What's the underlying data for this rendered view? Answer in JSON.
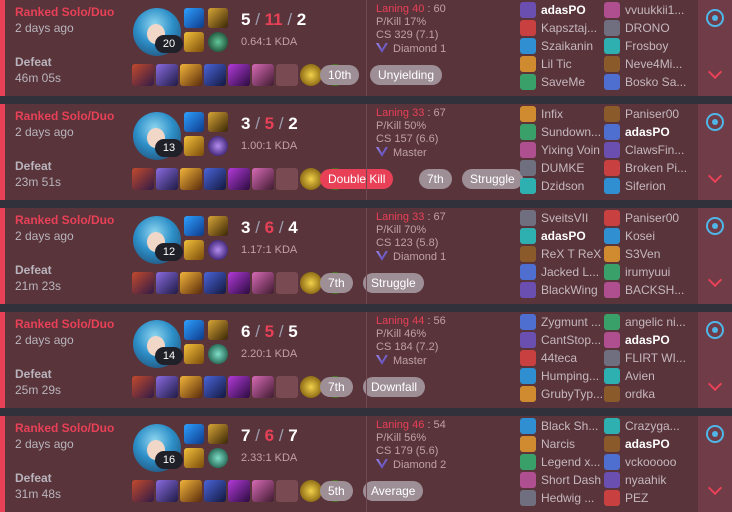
{
  "matches": [
    {
      "queue": "Ranked Solo/Duo",
      "ago": "2 days ago",
      "result": "Defeat",
      "duration": "46m 05s",
      "level": "20",
      "kills": "5",
      "deaths": "11",
      "assists": "2",
      "ratio": "0.64:1 KDA",
      "laning_label": "Laning",
      "laning_left": "40",
      "laning_right": "60",
      "pkill": "P/Kill 17%",
      "cs": "CS 329 (7.1)",
      "rank": "Diamond 1",
      "badges": [
        "10th",
        "Unyielding"
      ],
      "team_left": [
        "adasPO",
        "Kapsztaj...",
        "Szaikanin",
        "Lil Tic",
        "SaveMe"
      ],
      "team_right": [
        "vvuukkii1...",
        "DRONO",
        "Frosboy",
        "Neve4Mi...",
        "Bosko Sa..."
      ],
      "me": "L0"
    },
    {
      "queue": "Ranked Solo/Duo",
      "ago": "2 days ago",
      "result": "Defeat",
      "duration": "23m 51s",
      "level": "13",
      "kills": "3",
      "deaths": "5",
      "assists": "2",
      "ratio": "1.00:1 KDA",
      "laning_label": "Laning",
      "laning_left": "33",
      "laning_right": "67",
      "pkill": "P/Kill 50%",
      "cs": "CS 157 (6.6)",
      "rank": "Master",
      "badges": [
        "Double Kill",
        "7th",
        "Struggle"
      ],
      "team_left": [
        "Infix",
        "Sundown...",
        "Yixing Voin",
        "DUMKE",
        "Dzidson"
      ],
      "team_right": [
        "Paniser00",
        "adasPO",
        "ClawsFin...",
        "Broken Pi...",
        "Siferion"
      ],
      "me": "R1"
    },
    {
      "queue": "Ranked Solo/Duo",
      "ago": "2 days ago",
      "result": "Defeat",
      "duration": "21m 23s",
      "level": "12",
      "kills": "3",
      "deaths": "6",
      "assists": "4",
      "ratio": "1.17:1 KDA",
      "laning_label": "Laning",
      "laning_left": "33",
      "laning_right": "67",
      "pkill": "P/Kill 70%",
      "cs": "CS 123 (5.8)",
      "rank": "Diamond 1",
      "badges": [
        "7th",
        "Struggle"
      ],
      "team_left": [
        "SveitsVII",
        "adasPO",
        "ReX T ReX",
        "Jacked L...",
        "BlackWing"
      ],
      "team_right": [
        "Paniser00",
        "Kosei",
        "S3Ven",
        "irumyuui",
        "BACKSH..."
      ],
      "me": "L1"
    },
    {
      "queue": "Ranked Solo/Duo",
      "ago": "2 days ago",
      "result": "Defeat",
      "duration": "25m 29s",
      "level": "14",
      "kills": "6",
      "deaths": "5",
      "assists": "5",
      "ratio": "2.20:1 KDA",
      "laning_label": "Laning",
      "laning_left": "44",
      "laning_right": "56",
      "pkill": "P/Kill 46%",
      "cs": "CS 184 (7.2)",
      "rank": "Master",
      "badges": [
        "7th",
        "Downfall"
      ],
      "team_left": [
        "Zygmunt ...",
        "CantStop...",
        "44teca",
        "Humping...",
        "GrubyTyp..."
      ],
      "team_right": [
        "angelic ni...",
        "adasPO",
        "FLIRT WI...",
        "Avien",
        "ordka"
      ],
      "me": "R1"
    },
    {
      "queue": "Ranked Solo/Duo",
      "ago": "2 days ago",
      "result": "Defeat",
      "duration": "31m 48s",
      "level": "16",
      "kills": "7",
      "deaths": "6",
      "assists": "7",
      "ratio": "2.33:1 KDA",
      "laning_label": "Laning",
      "laning_left": "46",
      "laning_right": "54",
      "pkill": "P/Kill 56%",
      "cs": "CS 179 (5.6)",
      "rank": "Diamond 2",
      "badges": [
        "5th",
        "Average"
      ],
      "team_left": [
        "Black Sh...",
        "Narcis",
        "Legend x...",
        "Short Dash",
        "Hedwig ..."
      ],
      "team_right": [
        "Crazyga...",
        "adasPO",
        "vckooooo",
        "nyaahik",
        "PEZ"
      ],
      "me": "R1"
    }
  ]
}
